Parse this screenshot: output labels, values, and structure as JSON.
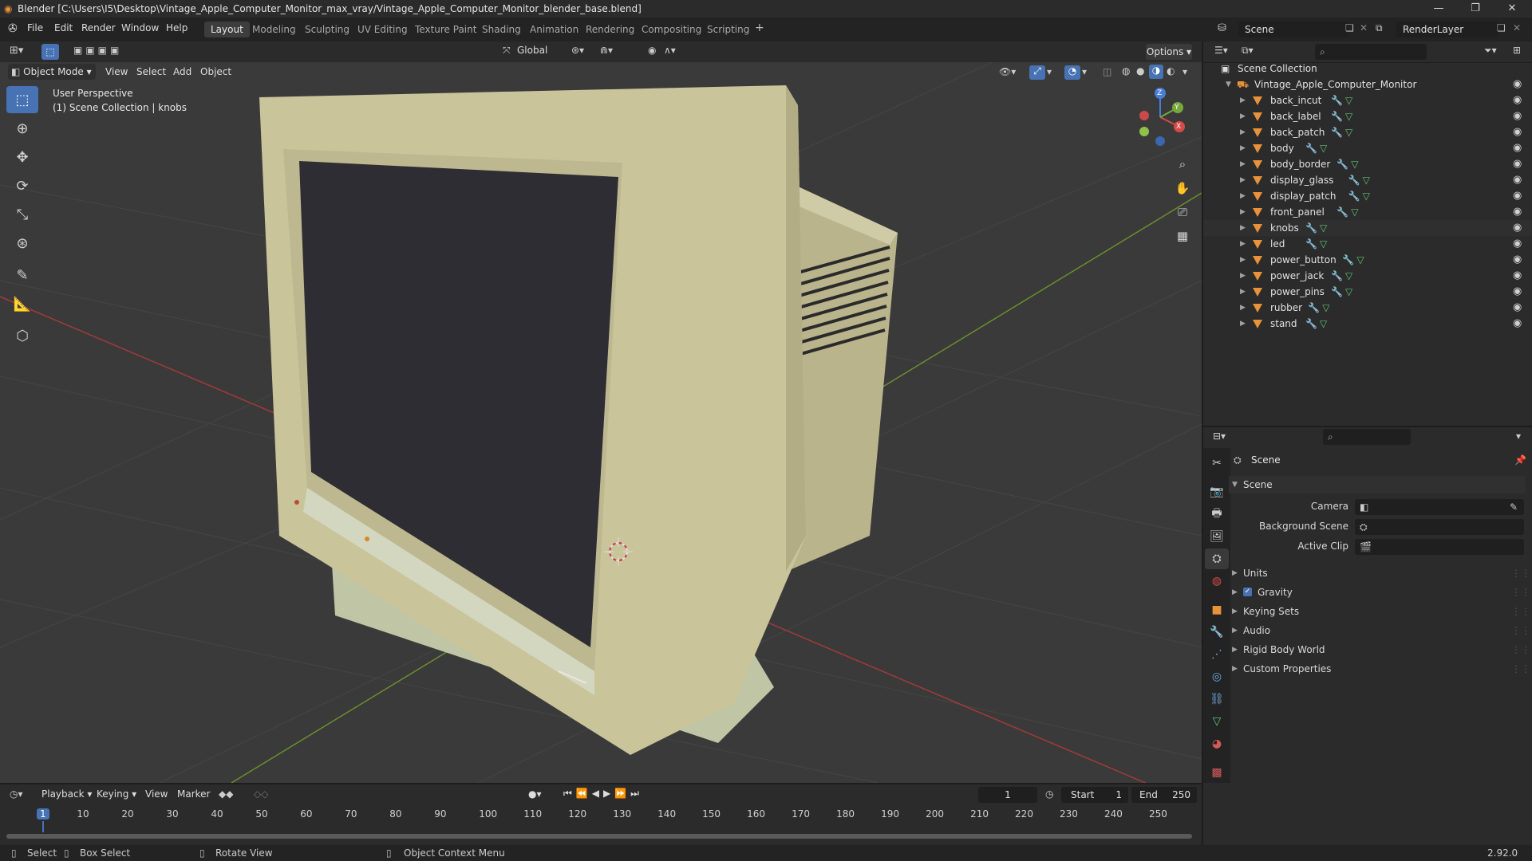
{
  "window": {
    "title": "Blender [C:\\Users\\I5\\Desktop\\Vintage_Apple_Computer_Monitor_max_vray/Vintage_Apple_Computer_Monitor_blender_base.blend]"
  },
  "menubar": {
    "items": [
      "File",
      "Edit",
      "Render",
      "Window",
      "Help"
    ],
    "workspaces": [
      "Layout",
      "Modeling",
      "Sculpting",
      "UV Editing",
      "Texture Paint",
      "Shading",
      "Animation",
      "Rendering",
      "Compositing",
      "Scripting"
    ],
    "active_workspace": "Layout",
    "scene_name": "Scene",
    "view_layer": "RenderLayer"
  },
  "viewport": {
    "mode": "Object Mode",
    "menus": [
      "View",
      "Select",
      "Add",
      "Object"
    ],
    "transform_orientation": "Global",
    "options_label": "Options",
    "perspective_label": "User Perspective",
    "collection_label": "(1) Scene Collection | knobs",
    "axes": {
      "x": "X",
      "y": "Y",
      "z": "Z"
    }
  },
  "outliner": {
    "root": "Scene Collection",
    "collection": "Vintage_Apple_Computer_Monitor",
    "objects": [
      "back_incut",
      "back_label",
      "back_patch",
      "body",
      "body_border",
      "display_glass",
      "display_patch",
      "front_panel",
      "knobs",
      "led",
      "power_button",
      "power_jack",
      "power_pins",
      "rubber",
      "stand"
    ]
  },
  "properties": {
    "header": "Scene",
    "panel_title": "Scene",
    "fields": [
      {
        "label": "Camera"
      },
      {
        "label": "Background Scene"
      },
      {
        "label": "Active Clip"
      }
    ],
    "subpanels": [
      {
        "label": "Units",
        "checkbox": false
      },
      {
        "label": "Gravity",
        "checkbox": true
      },
      {
        "label": "Keying Sets",
        "checkbox": false
      },
      {
        "label": "Audio",
        "checkbox": false
      },
      {
        "label": "Rigid Body World",
        "checkbox": false
      },
      {
        "label": "Custom Properties",
        "checkbox": false
      }
    ]
  },
  "timeline": {
    "menus": [
      "Playback",
      "Keying",
      "View",
      "Marker"
    ],
    "current_frame": "1",
    "start_label": "Start",
    "start_value": "1",
    "end_label": "End",
    "end_value": "250",
    "ticks": [
      "1",
      "10",
      "20",
      "30",
      "40",
      "50",
      "60",
      "70",
      "80",
      "90",
      "100",
      "110",
      "120",
      "130",
      "140",
      "150",
      "160",
      "170",
      "180",
      "190",
      "200",
      "210",
      "220",
      "230",
      "240",
      "250"
    ]
  },
  "statusbar": {
    "select": "Select",
    "box_select": "Box Select",
    "rotate": "Rotate View",
    "context_menu": "Object Context Menu",
    "version": "2.92.0"
  },
  "colors": {
    "accent": "#4772b3",
    "object_orange": "#e8923a",
    "modifier_blue": "#6fa8dc",
    "mesh_green": "#63c174",
    "monitor": "#c9c49a"
  }
}
